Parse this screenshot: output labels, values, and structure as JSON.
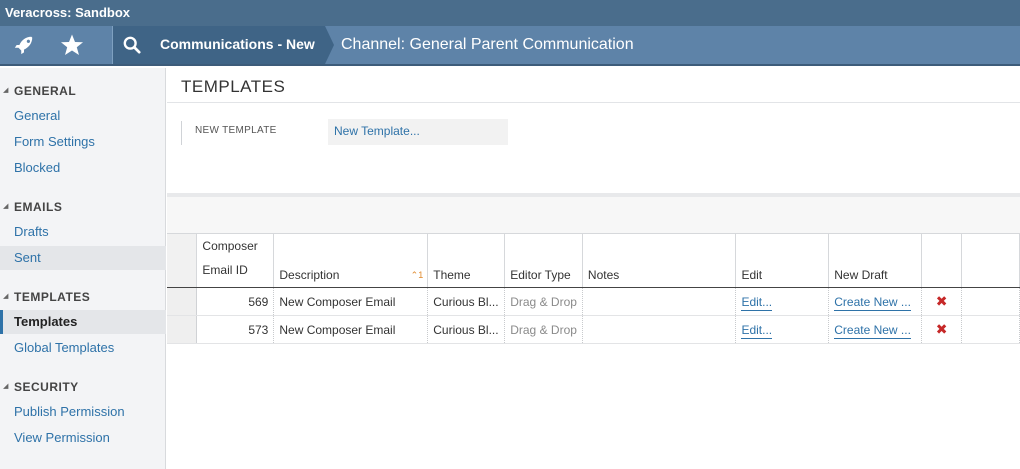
{
  "window": {
    "title": "Veracross: Sandbox"
  },
  "nav": {
    "icons": [
      "rocket-icon",
      "star-icon",
      "search-icon"
    ],
    "breadcrumb_current": "Communications - New",
    "channel_title": "Channel: General Parent Communication"
  },
  "sidebar": {
    "sections": [
      {
        "label": "GENERAL",
        "items": [
          "General",
          "Form Settings",
          "Blocked"
        ]
      },
      {
        "label": "EMAILS",
        "items": [
          "Drafts",
          "Sent"
        ]
      },
      {
        "label": "TEMPLATES",
        "items": [
          "Templates",
          "Global Templates"
        ]
      },
      {
        "label": "SECURITY",
        "items": [
          "Publish Permission",
          "View Permission"
        ]
      }
    ],
    "active_item": "Templates",
    "hover_item": "Sent"
  },
  "main": {
    "title": "TEMPLATES",
    "form": {
      "new_template_label": "NEW TEMPLATE",
      "new_template_value": "New Template..."
    }
  },
  "grid": {
    "columns": [
      "Composer\nEmail ID",
      "Description",
      "Theme",
      "Editor Type",
      "Notes",
      "Edit",
      "New Draft",
      ""
    ],
    "sort": {
      "column": "Description",
      "order": "1"
    },
    "rows": [
      {
        "id": "569",
        "description": "New Composer Email",
        "theme": "Curious Bl...",
        "editor_type": "Drag & Drop",
        "notes": "",
        "edit": "Edit...",
        "new_draft": "Create New ..."
      },
      {
        "id": "573",
        "description": "New Composer Email",
        "theme": "Curious Bl...",
        "editor_type": "Drag & Drop",
        "notes": "",
        "edit": "Edit...",
        "new_draft": "Create New ..."
      }
    ]
  }
}
